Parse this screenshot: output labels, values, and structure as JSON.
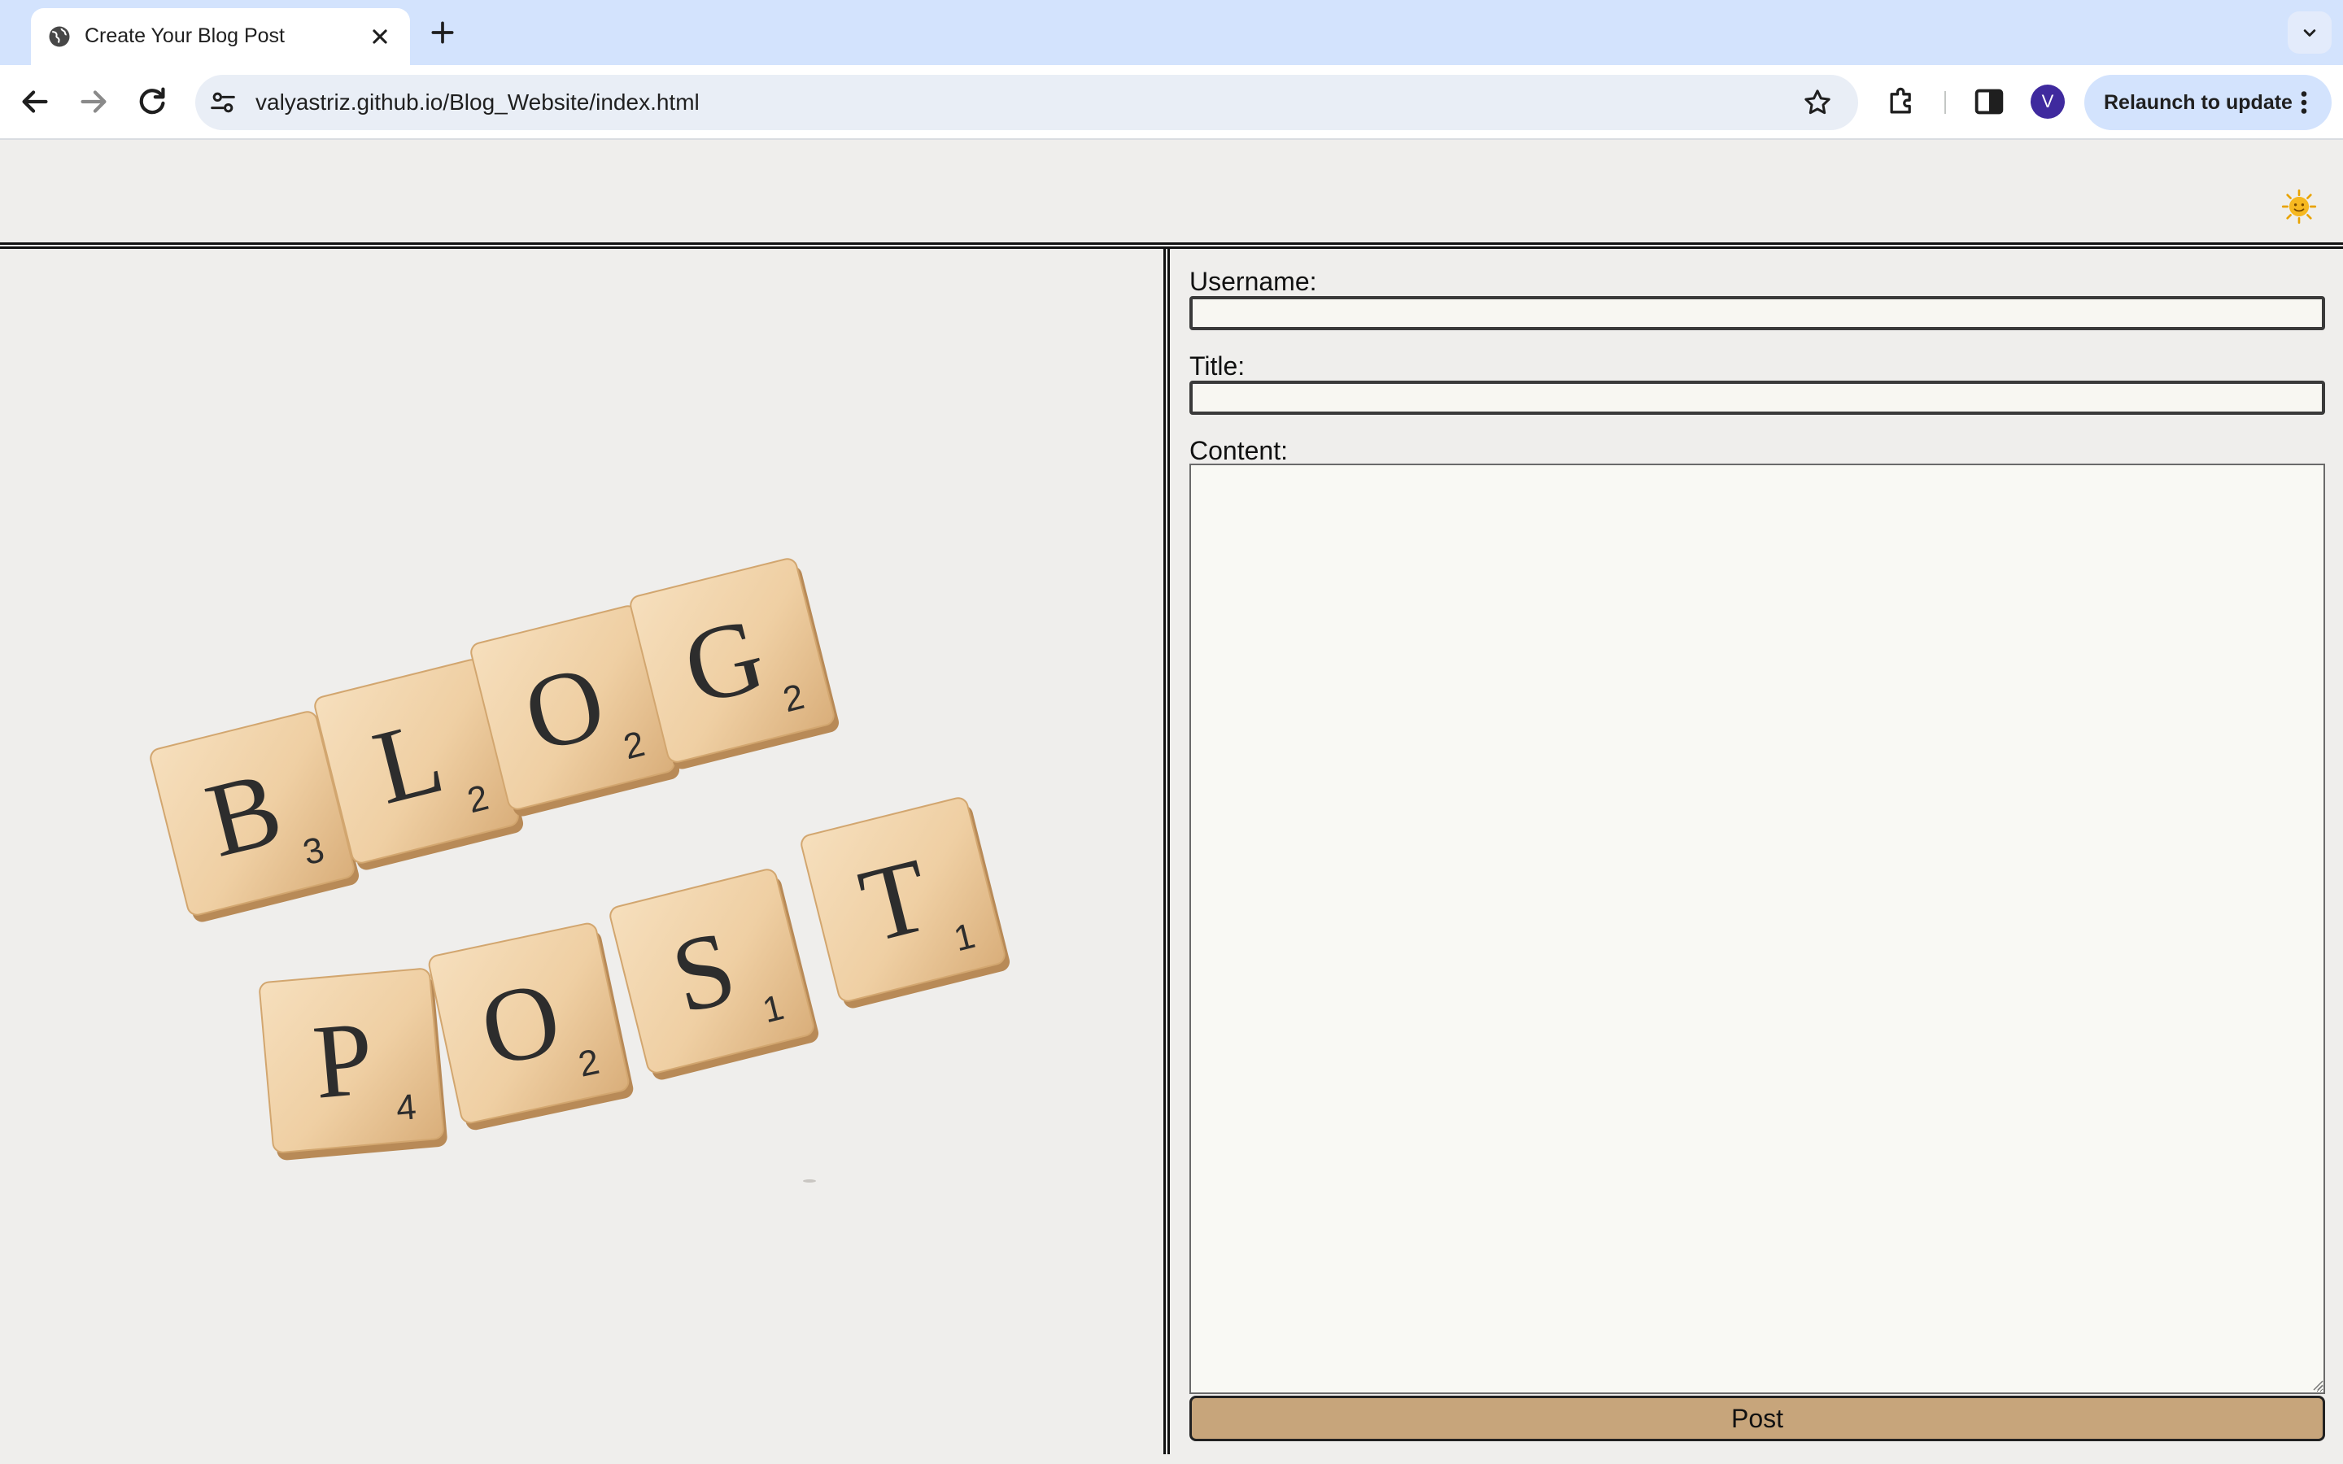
{
  "browser": {
    "tab_title": "Create Your Blog Post",
    "url": "valyastriz.github.io/Blog_Website/index.html",
    "profile_initial": "V",
    "relaunch_label": "Relaunch to update"
  },
  "page": {
    "theme_toggle_icon": "sun-face-icon",
    "hero_image": {
      "row1": [
        {
          "letter": "B",
          "score": "3"
        },
        {
          "letter": "L",
          "score": "2"
        },
        {
          "letter": "O",
          "score": "2"
        },
        {
          "letter": "G",
          "score": "2"
        }
      ],
      "row2": [
        {
          "letter": "P",
          "score": "4"
        },
        {
          "letter": "O",
          "score": "2"
        },
        {
          "letter": "S",
          "score": "1"
        },
        {
          "letter": "T",
          "score": "1"
        }
      ]
    },
    "form": {
      "username_label": "Username:",
      "username_value": "",
      "title_label": "Title:",
      "title_value": "",
      "content_label": "Content:",
      "content_value": "",
      "submit_label": "Post"
    }
  },
  "colors": {
    "tab_strip": "#d3e3fd",
    "page_background": "#efeeec",
    "post_button": "#c7a57b",
    "tile": "#f0d3ab"
  }
}
